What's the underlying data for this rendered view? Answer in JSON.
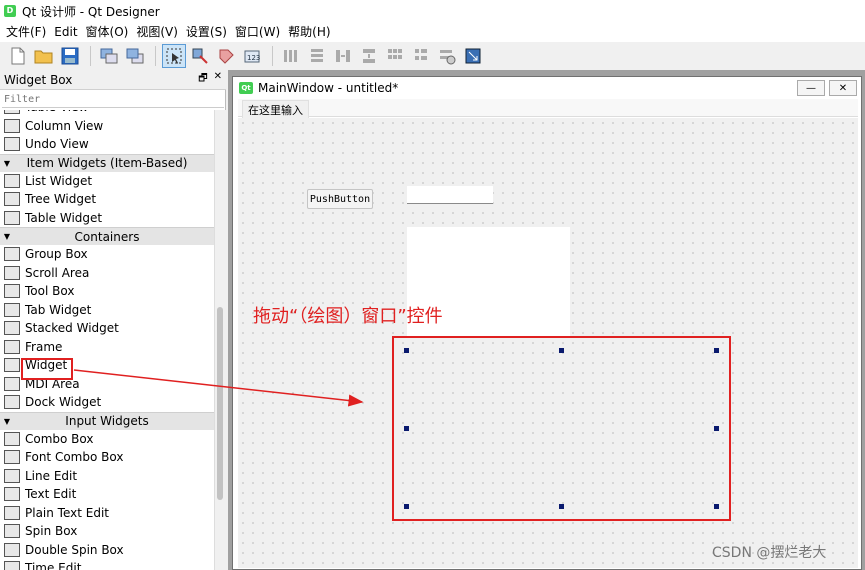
{
  "app": {
    "title": "Qt 设计师 - Qt Designer",
    "badge": "D"
  },
  "menubar": [
    "文件(F)",
    "Edit",
    "窗体(O)",
    "视图(V)",
    "设置(S)",
    "窗口(W)",
    "帮助(H)"
  ],
  "toolbar": {
    "icons": [
      "new-file-icon",
      "open-folder-icon",
      "save-icon",
      "send-to-back-icon",
      "bring-to-front-icon",
      "edit-widgets-icon",
      "edit-signals-slots-icon",
      "edit-buddies-icon",
      "edit-tab-order-icon",
      "layout-horizontal-icon",
      "layout-vertical-icon",
      "layout-horizontal-splitter-icon",
      "layout-vertical-splitter-icon",
      "layout-grid-icon",
      "layout-form-icon",
      "break-layout-icon",
      "adjust-size-icon"
    ]
  },
  "widget_box": {
    "title": "Widget Box",
    "filter_placeholder": "Filter",
    "items": [
      {
        "type": "item",
        "label": "Table View",
        "icon": "table-view-icon"
      },
      {
        "type": "item",
        "label": "Column View",
        "icon": "column-view-icon"
      },
      {
        "type": "item",
        "label": "Undo View",
        "icon": "undo-view-icon"
      },
      {
        "type": "category",
        "label": "Item Widgets (Item-Based)"
      },
      {
        "type": "item",
        "label": "List Widget",
        "icon": "list-widget-icon"
      },
      {
        "type": "item",
        "label": "Tree Widget",
        "icon": "tree-widget-icon"
      },
      {
        "type": "item",
        "label": "Table Widget",
        "icon": "table-widget-icon"
      },
      {
        "type": "category",
        "label": "Containers"
      },
      {
        "type": "item",
        "label": "Group Box",
        "icon": "group-box-icon"
      },
      {
        "type": "item",
        "label": "Scroll Area",
        "icon": "scroll-area-icon"
      },
      {
        "type": "item",
        "label": "Tool Box",
        "icon": "tool-box-icon"
      },
      {
        "type": "item",
        "label": "Tab Widget",
        "icon": "tab-widget-icon"
      },
      {
        "type": "item",
        "label": "Stacked Widget",
        "icon": "stacked-widget-icon"
      },
      {
        "type": "item",
        "label": "Frame",
        "icon": "frame-icon"
      },
      {
        "type": "item",
        "label": "Widget",
        "icon": "widget-icon"
      },
      {
        "type": "item",
        "label": "MDI Area",
        "icon": "mdi-area-icon"
      },
      {
        "type": "item",
        "label": "Dock Widget",
        "icon": "dock-widget-icon"
      },
      {
        "type": "category",
        "label": "Input Widgets"
      },
      {
        "type": "item",
        "label": "Combo Box",
        "icon": "combo-box-icon"
      },
      {
        "type": "item",
        "label": "Font Combo Box",
        "icon": "font-combo-box-icon"
      },
      {
        "type": "item",
        "label": "Line Edit",
        "icon": "line-edit-icon"
      },
      {
        "type": "item",
        "label": "Text Edit",
        "icon": "text-edit-icon"
      },
      {
        "type": "item",
        "label": "Plain Text Edit",
        "icon": "plain-text-edit-icon"
      },
      {
        "type": "item",
        "label": "Spin Box",
        "icon": "spin-box-icon"
      },
      {
        "type": "item",
        "label": "Double Spin Box",
        "icon": "double-spin-box-icon"
      },
      {
        "type": "item",
        "label": "Time Edit",
        "icon": "time-edit-icon"
      }
    ]
  },
  "form": {
    "title": "MainWindow - untitled*",
    "badge": "Qt",
    "menu_placeholder": "在这里输入",
    "push_button_label": "PushButton"
  },
  "annotation": "拖动“（绘图）窗口”控件",
  "watermark": "CSDN @摆烂老大",
  "colors": {
    "annotation_red": "#e02020",
    "qt_green": "#41cd52",
    "handle_navy": "#0a1a6e"
  }
}
